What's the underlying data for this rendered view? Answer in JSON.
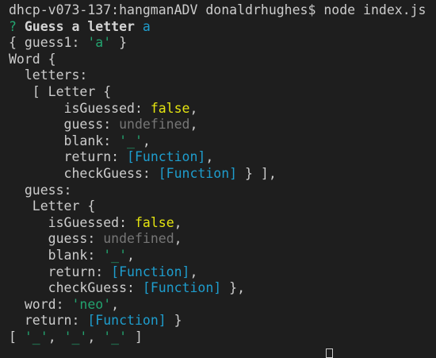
{
  "terminal": {
    "colors": {
      "background": "#1e1e1e",
      "default": "#cccccc",
      "green": "#23a36f",
      "blue": "#1e9dcd",
      "yellow": "#e5e510",
      "gray": "#767676"
    },
    "lines": [
      [
        {
          "t": "dhcp-v073-137:hangmanADV donaldrhughes$ node index.js",
          "c": "default"
        }
      ],
      [
        {
          "t": "? ",
          "c": "green"
        },
        {
          "t": "Guess a letter ",
          "c": "bold"
        },
        {
          "t": "a",
          "c": "blue"
        }
      ],
      [
        {
          "t": "{ guess1: ",
          "c": "default"
        },
        {
          "t": "'a'",
          "c": "green"
        },
        {
          "t": " }",
          "c": "default"
        }
      ],
      [
        {
          "t": "Word {",
          "c": "default"
        }
      ],
      [
        {
          "t": "  letters:",
          "c": "default"
        }
      ],
      [
        {
          "t": "   [ Letter {",
          "c": "default"
        }
      ],
      [
        {
          "t": "       isGuessed: ",
          "c": "default"
        },
        {
          "t": "false",
          "c": "yellow"
        },
        {
          "t": ",",
          "c": "default"
        }
      ],
      [
        {
          "t": "       guess: ",
          "c": "default"
        },
        {
          "t": "undefined",
          "c": "gray"
        },
        {
          "t": ",",
          "c": "default"
        }
      ],
      [
        {
          "t": "       blank: ",
          "c": "default"
        },
        {
          "t": "'_'",
          "c": "green"
        },
        {
          "t": ",",
          "c": "default"
        }
      ],
      [
        {
          "t": "       return: ",
          "c": "default"
        },
        {
          "t": "[Function]",
          "c": "blue"
        },
        {
          "t": ",",
          "c": "default"
        }
      ],
      [
        {
          "t": "       checkGuess: ",
          "c": "default"
        },
        {
          "t": "[Function]",
          "c": "blue"
        },
        {
          "t": " } ],",
          "c": "default"
        }
      ],
      [
        {
          "t": "  guess:",
          "c": "default"
        }
      ],
      [
        {
          "t": "   Letter {",
          "c": "default"
        }
      ],
      [
        {
          "t": "     isGuessed: ",
          "c": "default"
        },
        {
          "t": "false",
          "c": "yellow"
        },
        {
          "t": ",",
          "c": "default"
        }
      ],
      [
        {
          "t": "     guess: ",
          "c": "default"
        },
        {
          "t": "undefined",
          "c": "gray"
        },
        {
          "t": ",",
          "c": "default"
        }
      ],
      [
        {
          "t": "     blank: ",
          "c": "default"
        },
        {
          "t": "'_'",
          "c": "green"
        },
        {
          "t": ",",
          "c": "default"
        }
      ],
      [
        {
          "t": "     return: ",
          "c": "default"
        },
        {
          "t": "[Function]",
          "c": "blue"
        },
        {
          "t": ",",
          "c": "default"
        }
      ],
      [
        {
          "t": "     checkGuess: ",
          "c": "default"
        },
        {
          "t": "[Function]",
          "c": "blue"
        },
        {
          "t": " },",
          "c": "default"
        }
      ],
      [
        {
          "t": "  word: ",
          "c": "default"
        },
        {
          "t": "'neo'",
          "c": "green"
        },
        {
          "t": ",",
          "c": "default"
        }
      ],
      [
        {
          "t": "  return: ",
          "c": "default"
        },
        {
          "t": "[Function]",
          "c": "blue"
        },
        {
          "t": " }",
          "c": "default"
        }
      ],
      [
        {
          "t": "[ ",
          "c": "default"
        },
        {
          "t": "'_'",
          "c": "green"
        },
        {
          "t": ", ",
          "c": "default"
        },
        {
          "t": "'_'",
          "c": "green"
        },
        {
          "t": ", ",
          "c": "default"
        },
        {
          "t": "'_'",
          "c": "green"
        },
        {
          "t": " ]",
          "c": "default"
        }
      ]
    ]
  }
}
